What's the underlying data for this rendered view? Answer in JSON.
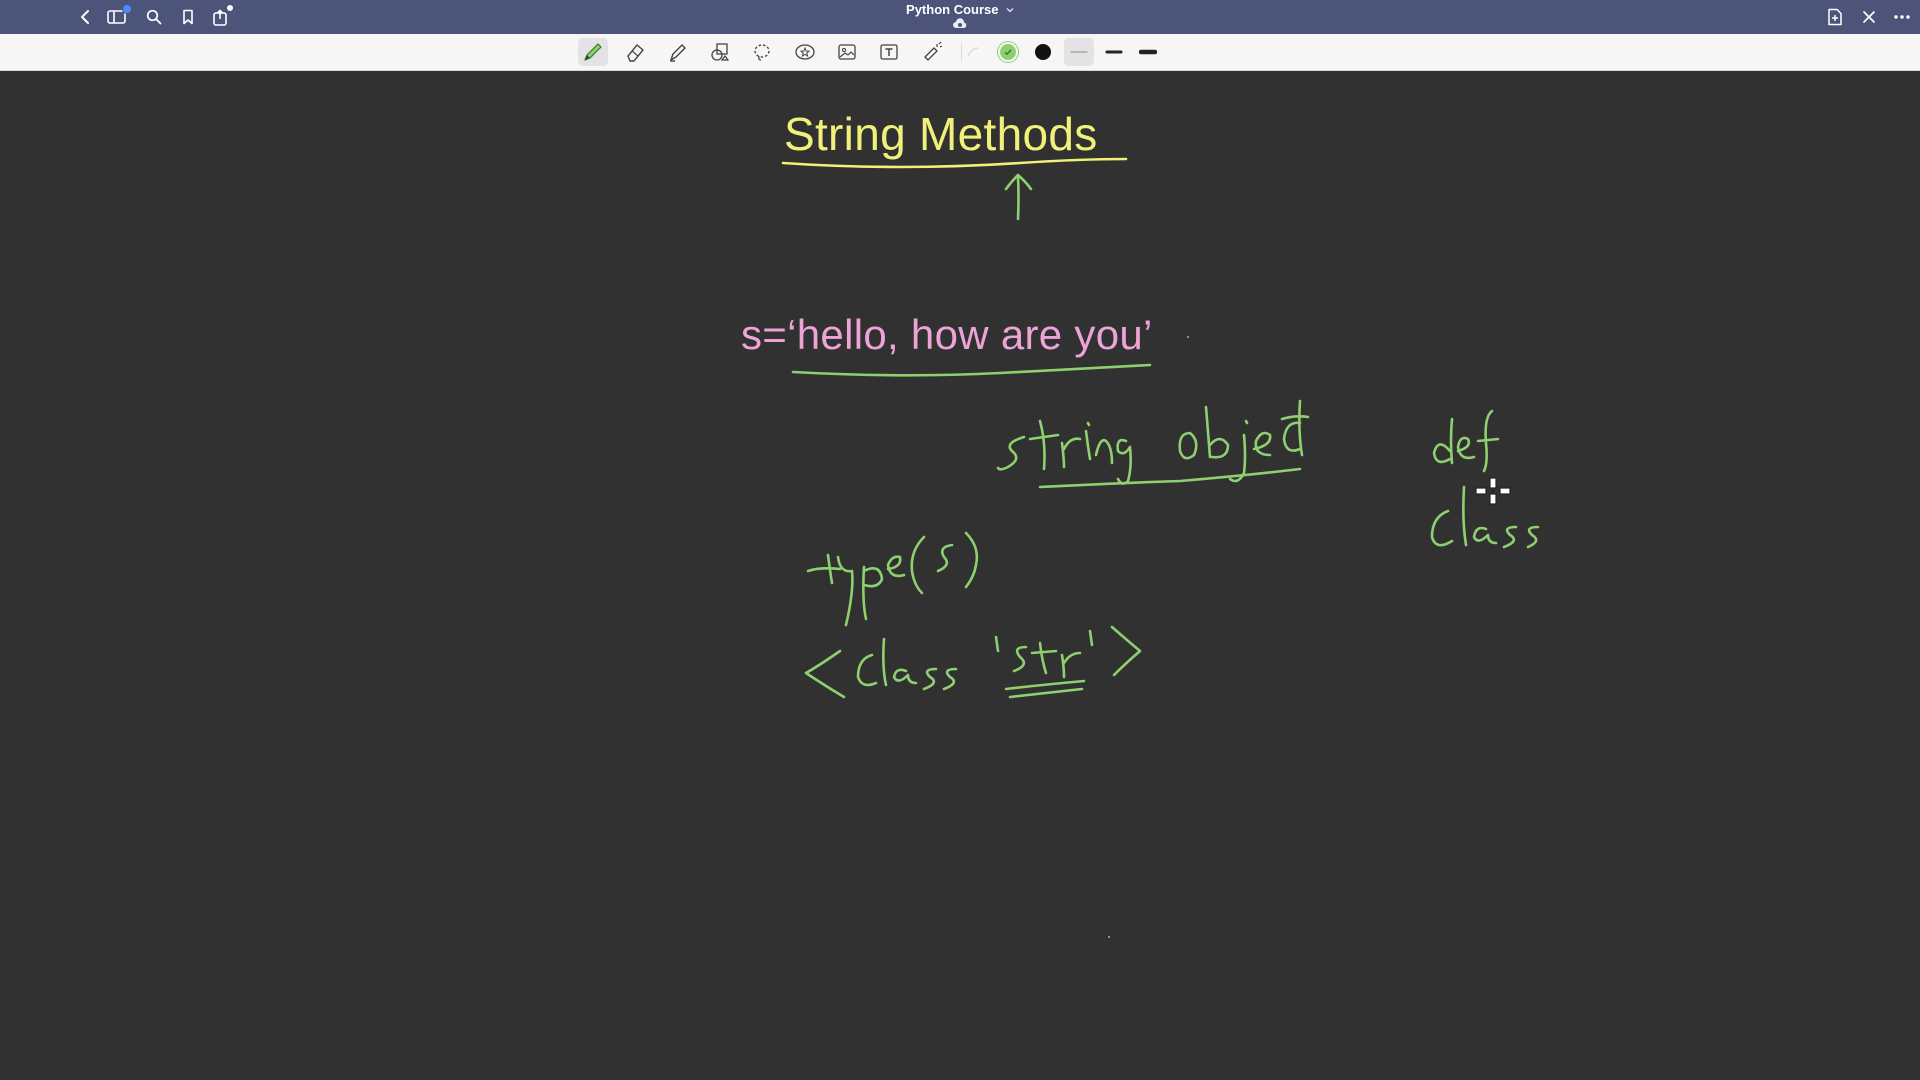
{
  "window": {
    "title": "Python Course",
    "title_caret": "chevron-down-icon"
  },
  "titlebar": {
    "left_buttons": [
      "back-icon",
      "sidebar-icon",
      "search-icon",
      "bookmark-icon",
      "share-icon"
    ],
    "right_buttons": [
      "add-page-icon",
      "close-icon",
      "more-icon"
    ]
  },
  "toolbar": {
    "tools": [
      "pen-tool",
      "eraser-tool",
      "highlighter-tool",
      "shapes-tool",
      "lasso-tool",
      "elements-tool",
      "image-tool",
      "text-tool",
      "laser-pointer-tool"
    ],
    "selected_tool": "pen-tool",
    "colors": [
      "#8ed06f",
      "#111111"
    ],
    "selected_color": "#8ed06f",
    "stroke_widths": [
      "thin",
      "medium",
      "thick"
    ],
    "selected_stroke": "thin"
  },
  "canvas": {
    "background": "#313131",
    "typed_title": "String Methods",
    "typed_code": "s=‘hello, how are you’",
    "handwriting": {
      "line1": "string object",
      "line2": "type(s)",
      "line3": "<class 'str'>",
      "side1": "def",
      "side2": "class"
    },
    "ink_colors": {
      "green": "#8ed06f",
      "yellow": "#f1f07a",
      "pink": "#eea3d6"
    }
  }
}
